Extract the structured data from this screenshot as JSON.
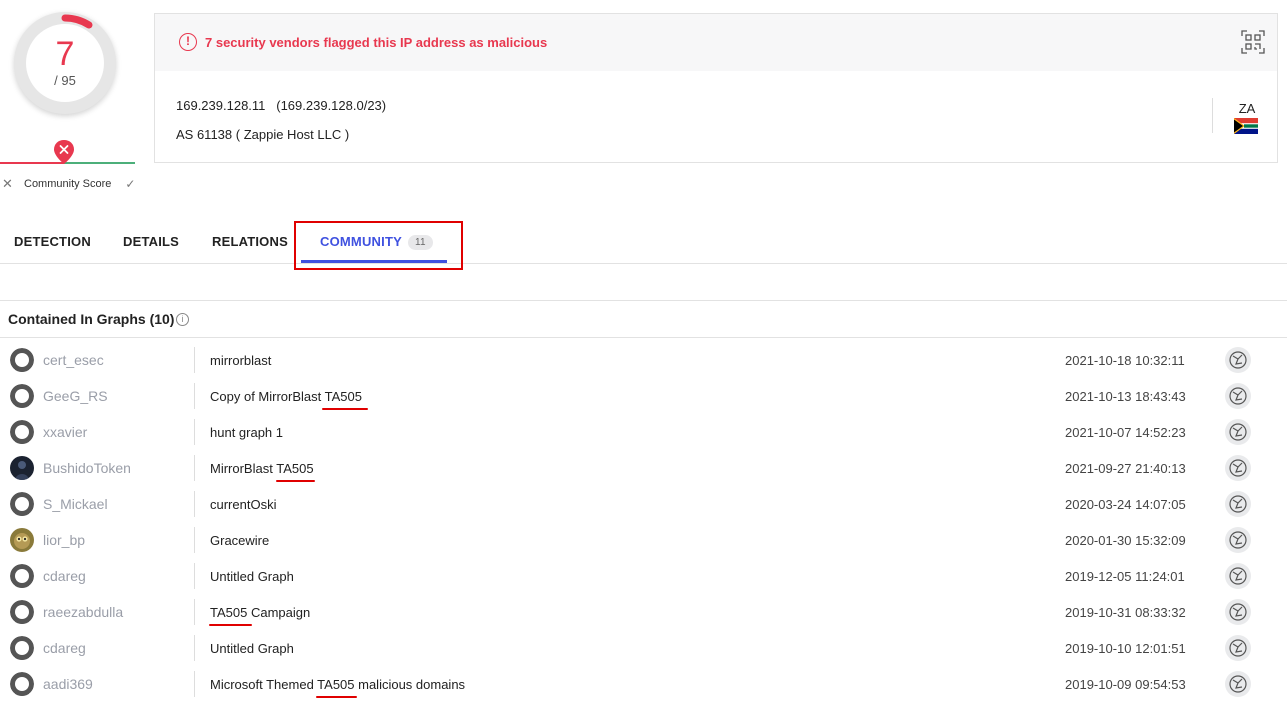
{
  "score": {
    "value": "7",
    "total": "/ 95",
    "community_label": "Community Score",
    "colors": {
      "malicious": "#e8384f",
      "harmless": "#4caf7a"
    }
  },
  "header": {
    "alert": "7 security vendors flagged this IP address as malicious",
    "ip": "169.239.128.11",
    "range": "(169.239.128.0/23)",
    "asn": "AS 61138 ( Zappie Host LLC )",
    "country": "ZA",
    "flag_icon": "south-africa-flag-icon"
  },
  "tabs": [
    {
      "label": "DETECTION"
    },
    {
      "label": "DETAILS"
    },
    {
      "label": "RELATIONS"
    },
    {
      "label": "COMMUNITY",
      "badge": "11"
    }
  ],
  "active_tab": "COMMUNITY",
  "section": {
    "title": "Contained In Graphs (10)"
  },
  "graphs": [
    {
      "user": "cert_esec",
      "name": "mirrorblast",
      "date": "2021-10-18 10:32:11",
      "avatar": "default"
    },
    {
      "user": "GeeG_RS",
      "name": "Copy of MirrorBlast TA505",
      "date": "2021-10-13 18:43:43",
      "avatar": "default"
    },
    {
      "user": "xxavier",
      "name": "hunt graph 1",
      "date": "2021-10-07 14:52:23",
      "avatar": "default"
    },
    {
      "user": "BushidoToken",
      "name": "MirrorBlast TA505",
      "date": "2021-09-27 21:40:13",
      "avatar": "dark"
    },
    {
      "user": "S_Mickael",
      "name": "currentOski",
      "date": "2020-03-24 14:07:05",
      "avatar": "default"
    },
    {
      "user": "lior_bp",
      "name": "Gracewire",
      "date": "2020-01-30 15:32:09",
      "avatar": "owl"
    },
    {
      "user": "cdareg",
      "name": "Untitled Graph",
      "date": "2019-12-05 11:24:01",
      "avatar": "default"
    },
    {
      "user": "raeezabdulla",
      "name": "TA505 Campaign",
      "date": "2019-10-31 08:33:32",
      "avatar": "default"
    },
    {
      "user": "cdareg",
      "name": "Untitled Graph",
      "date": "2019-10-10 12:01:51",
      "avatar": "default"
    },
    {
      "user": "aadi369",
      "name": "Microsoft Themed TA505 malicious domains",
      "date": "2019-10-09 09:54:53",
      "avatar": "default"
    }
  ]
}
